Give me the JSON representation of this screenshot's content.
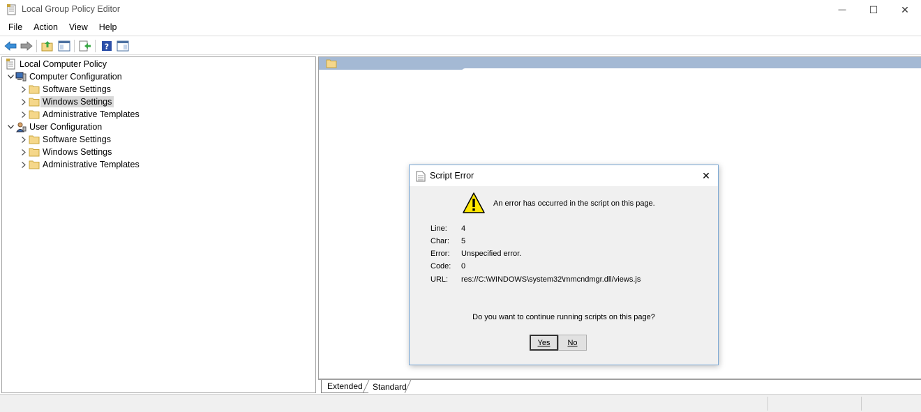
{
  "window": {
    "title": "Local Group Policy Editor",
    "minimize_glyph": "—",
    "maximize_glyph": "☐",
    "close_glyph": "✕"
  },
  "menu": {
    "file": "File",
    "action": "Action",
    "view": "View",
    "help": "Help"
  },
  "tree": {
    "root": "Local Computer Policy",
    "computer": {
      "label": "Computer Configuration",
      "software": "Software Settings",
      "windows": "Windows Settings",
      "admin": "Administrative Templates"
    },
    "user": {
      "label": "User Configuration",
      "software": "Software Settings",
      "windows": "Windows Settings",
      "admin": "Administrative Templates"
    }
  },
  "tabs": {
    "extended": "Extended",
    "standard": "Standard"
  },
  "dialog": {
    "title": "Script Error",
    "close_glyph": "✕",
    "message": "An error has occurred in the script on this page.",
    "labels": {
      "line": "Line:",
      "char": "Char:",
      "error": "Error:",
      "code": "Code:",
      "url": "URL:"
    },
    "values": {
      "line": "4",
      "char": "5",
      "error": "Unspecified error.",
      "code": "0",
      "url": "res://C:\\WINDOWS\\system32\\mmcndmgr.dll/views.js"
    },
    "question": "Do you want to continue running scripts on this page?",
    "yes_label": "Yes",
    "no_label": "No"
  },
  "colors": {
    "header_band": "#a4b9d4",
    "folder": "#f5d78a",
    "dialog_border": "#7aa7d4"
  }
}
